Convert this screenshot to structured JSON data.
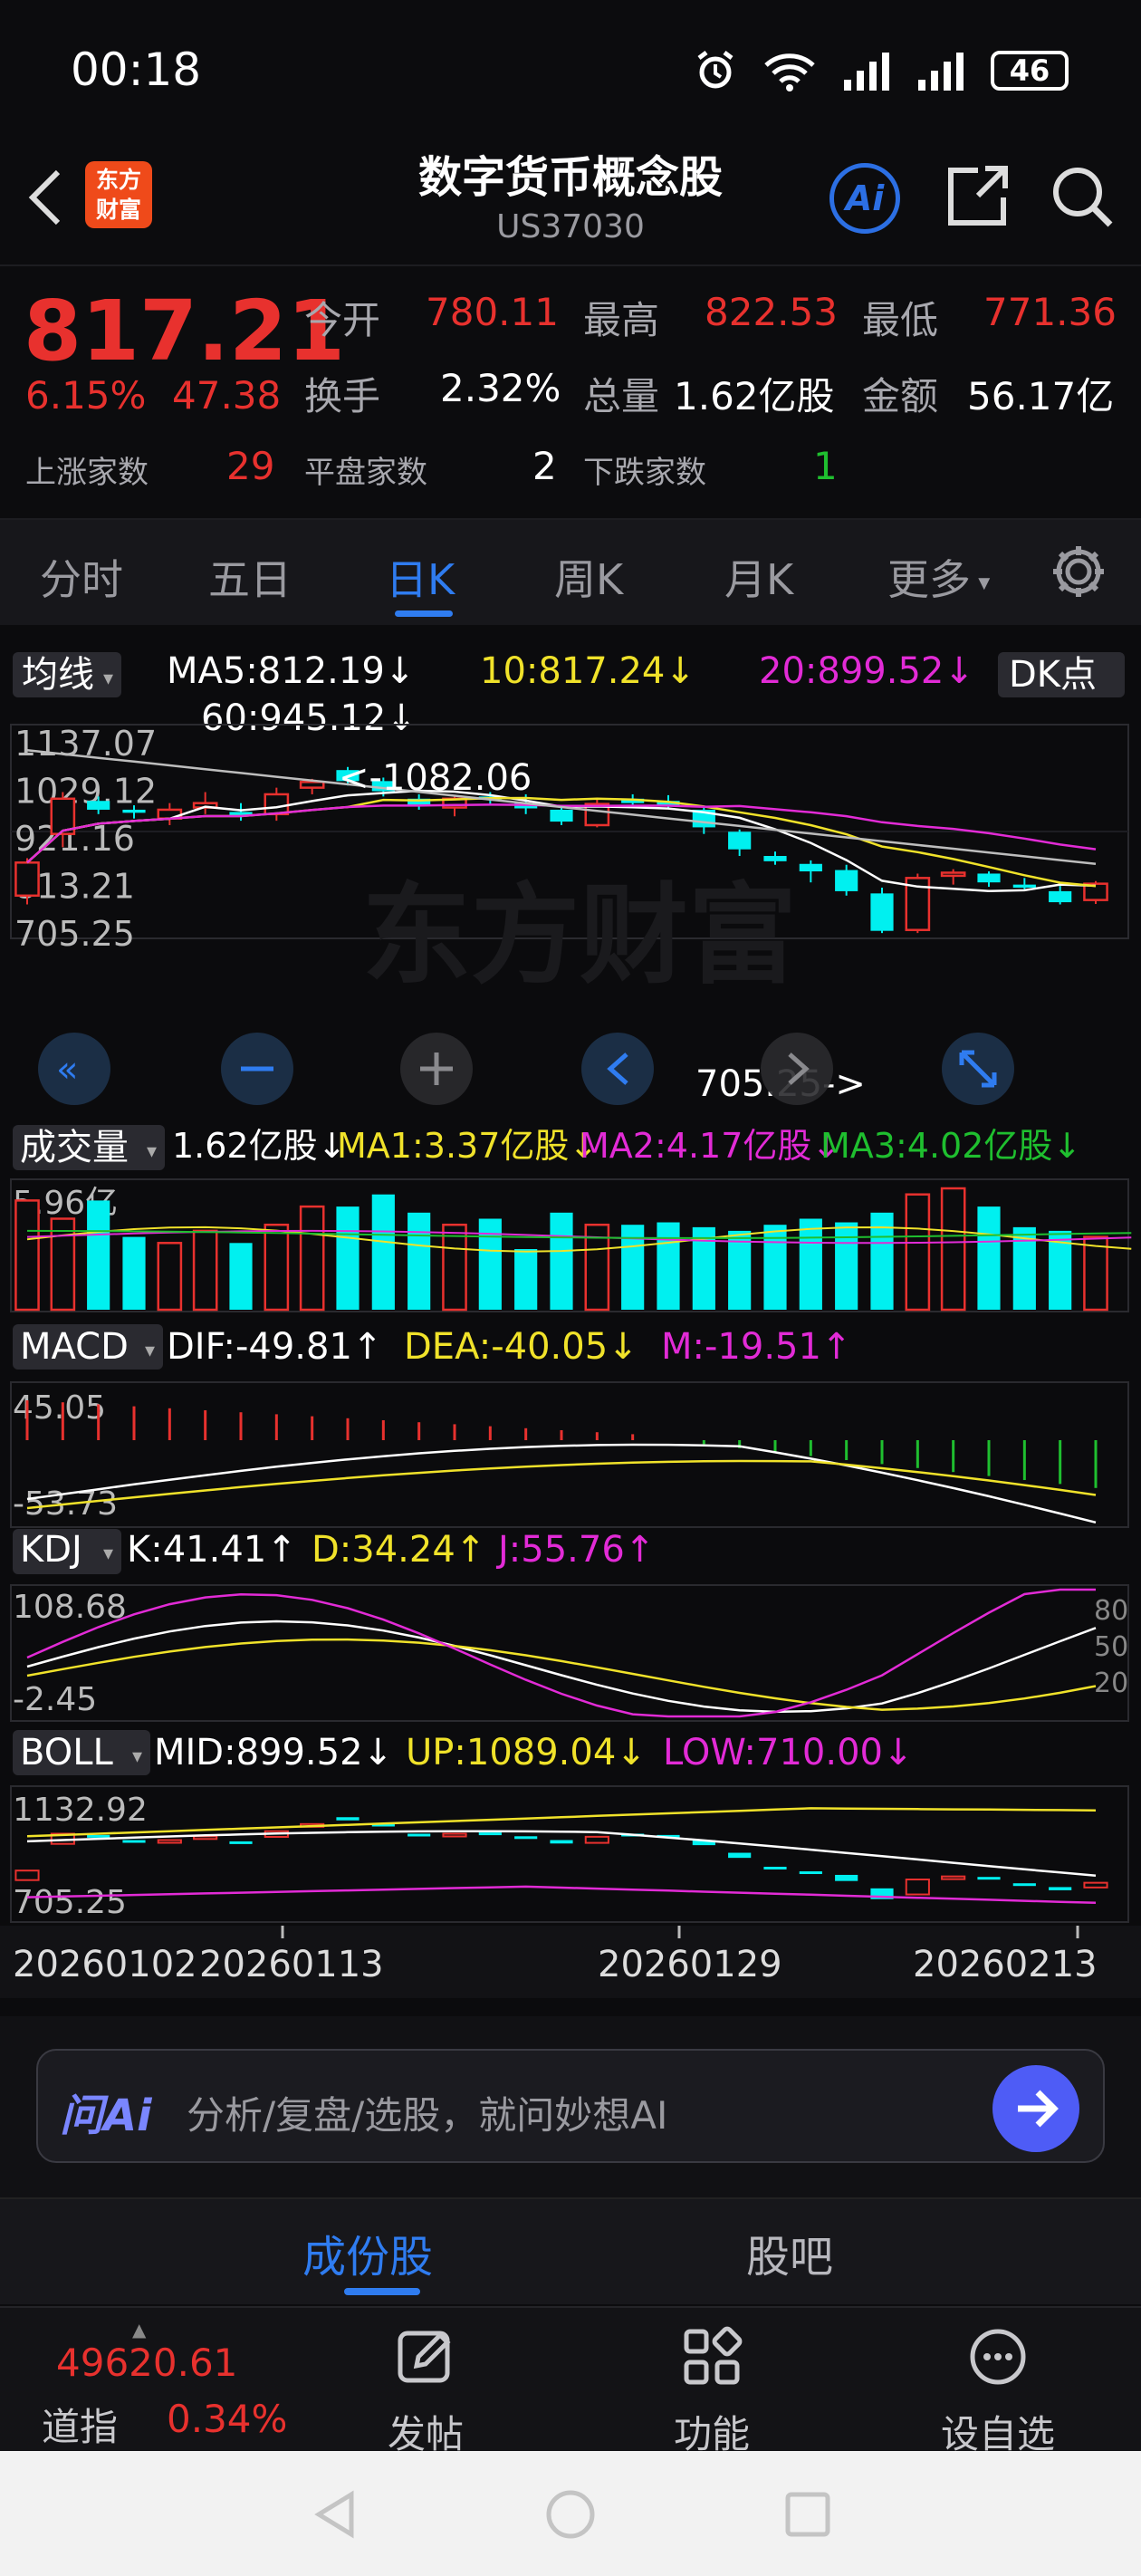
{
  "status_bar": {
    "time": "00:18",
    "battery": "46"
  },
  "header": {
    "logo_text": [
      "东方",
      "财富"
    ],
    "title": "数字货币概念股",
    "code": "US37030",
    "ai_label": "Ai"
  },
  "quote": {
    "price": "817.21",
    "pct": "6.15%",
    "change": "47.38",
    "open_label": "今开",
    "open": "780.11",
    "high_label": "最高",
    "high": "822.53",
    "low_label": "最低",
    "low": "771.36",
    "turnover_label": "换手",
    "turnover": "2.32%",
    "volume_label": "总量",
    "volume": "1.62亿股",
    "amount_label": "金额",
    "amount": "56.17亿",
    "up_label": "上涨家数",
    "up": "29",
    "flat_label": "平盘家数",
    "flat": "2",
    "down_label": "下跌家数",
    "down": "1"
  },
  "period_tabs": [
    "分时",
    "五日",
    "日K",
    "周K",
    "月K",
    "更多"
  ],
  "active_period": "日K",
  "indicators": {
    "ma_selector": "均线",
    "ma5": "MA5:812.19↓",
    "ma10": "10:817.24↓",
    "ma20": "20:899.52↓",
    "ma60": "60:945.12↓",
    "dk_button": "DK点",
    "vol_selector": "成交量",
    "vol_value": "1.62亿股↓",
    "vol_ma1": "MA1:3.37亿股↓",
    "vol_ma2": "MA2:4.17亿股↓",
    "vol_ma3": "MA3:4.02亿股↓",
    "macd_selector": "MACD",
    "dif": "DIF:-49.81↑",
    "dea": "DEA:-40.05↓",
    "m": "M:-19.51↑",
    "kdj_selector": "KDJ",
    "k": "K:41.41↑",
    "d": "D:34.24↑",
    "j": "J:55.76↑",
    "boll_selector": "BOLL",
    "mid": "MID:899.52↓",
    "up": "UP:1089.04↓",
    "low": "LOW:710.00↓"
  },
  "chart_labels": {
    "k_axis": [
      "1137.07",
      "1029.12",
      "921.16",
      "813.21",
      "705.25"
    ],
    "max_marker": "1082.06",
    "min_marker": "705.25->",
    "vol_axis": "5.96亿",
    "macd_axis": [
      "45.05",
      "-53.73"
    ],
    "kdj_axis": [
      "108.68",
      "-2.45"
    ],
    "kdj_right": [
      "80",
      "50",
      "20"
    ],
    "boll_axis": [
      "1132.92",
      "705.25"
    ],
    "dates": [
      "20260102",
      "20260113",
      "20260129",
      "20260213"
    ],
    "watermark": "东方财富"
  },
  "ask_ai": {
    "logo": "问Ai",
    "placeholder": "分析/复盘/选股，就问妙想AI"
  },
  "bottom_tabs": {
    "constituents": "成份股",
    "forum": "股吧"
  },
  "bottom_bar": {
    "index_value": "49620.61",
    "index_name": "道指",
    "index_pct": "0.34%",
    "post": "发帖",
    "functions": "功能",
    "watchlist": "设自选"
  },
  "colors": {
    "up": "#e8312e",
    "down": "#00f0f0",
    "accent": "#2f7cf0",
    "ma5": "#ffffff",
    "ma10": "#f0e22a",
    "ma20": "#e22bd6",
    "ma60": "#bdbdbd"
  },
  "chart_data": {
    "type": "candlestick",
    "dates": [
      "20260102",
      "20260105",
      "20260106",
      "20260107",
      "20260108",
      "20260109",
      "20260112",
      "20260113",
      "20260114",
      "20260115",
      "20260116",
      "20260119",
      "20260120",
      "20260121",
      "20260122",
      "20260123",
      "20260126",
      "20260127",
      "20260128",
      "20260129",
      "20260130",
      "20260202",
      "20260203",
      "20260204",
      "20260205",
      "20260206",
      "20260209",
      "20260210",
      "20260211",
      "20260212",
      "20260213",
      "20260214"
    ],
    "ohlc": [
      [
        790,
        875,
        770,
        865
      ],
      [
        930,
        1025,
        900,
        1010
      ],
      [
        1005,
        1015,
        975,
        985
      ],
      [
        985,
        995,
        965,
        978
      ],
      [
        965,
        1000,
        950,
        985
      ],
      [
        990,
        1025,
        975,
        1000
      ],
      [
        980,
        1000,
        960,
        970
      ],
      [
        975,
        1035,
        960,
        1020
      ],
      [
        1035,
        1055,
        1020,
        1048
      ],
      [
        1075,
        1082,
        1040,
        1050
      ],
      [
        1050,
        1058,
        1015,
        1027
      ],
      [
        1010,
        1020,
        985,
        995
      ],
      [
        990,
        1018,
        970,
        1010
      ],
      [
        1015,
        1025,
        995,
        1008
      ],
      [
        1000,
        1020,
        975,
        988
      ],
      [
        985,
        995,
        950,
        958
      ],
      [
        950,
        1010,
        945,
        998
      ],
      [
        1010,
        1020,
        990,
        1000
      ],
      [
        1005,
        1018,
        990,
        995
      ],
      [
        985,
        992,
        930,
        945
      ],
      [
        935,
        940,
        880,
        895
      ],
      [
        880,
        890,
        860,
        868
      ],
      [
        862,
        870,
        820,
        845
      ],
      [
        848,
        860,
        790,
        800
      ],
      [
        795,
        808,
        705,
        710
      ],
      [
        712,
        840,
        705,
        830
      ],
      [
        835,
        850,
        815,
        842
      ],
      [
        840,
        845,
        810,
        820
      ],
      [
        815,
        830,
        805,
        808
      ],
      [
        800,
        812,
        770,
        775
      ],
      [
        780,
        823,
        771,
        817
      ]
    ],
    "volume_axis_max": "5.96亿",
    "ma_lines": [
      "MA5",
      "MA10",
      "MA20",
      "MA60"
    ]
  }
}
